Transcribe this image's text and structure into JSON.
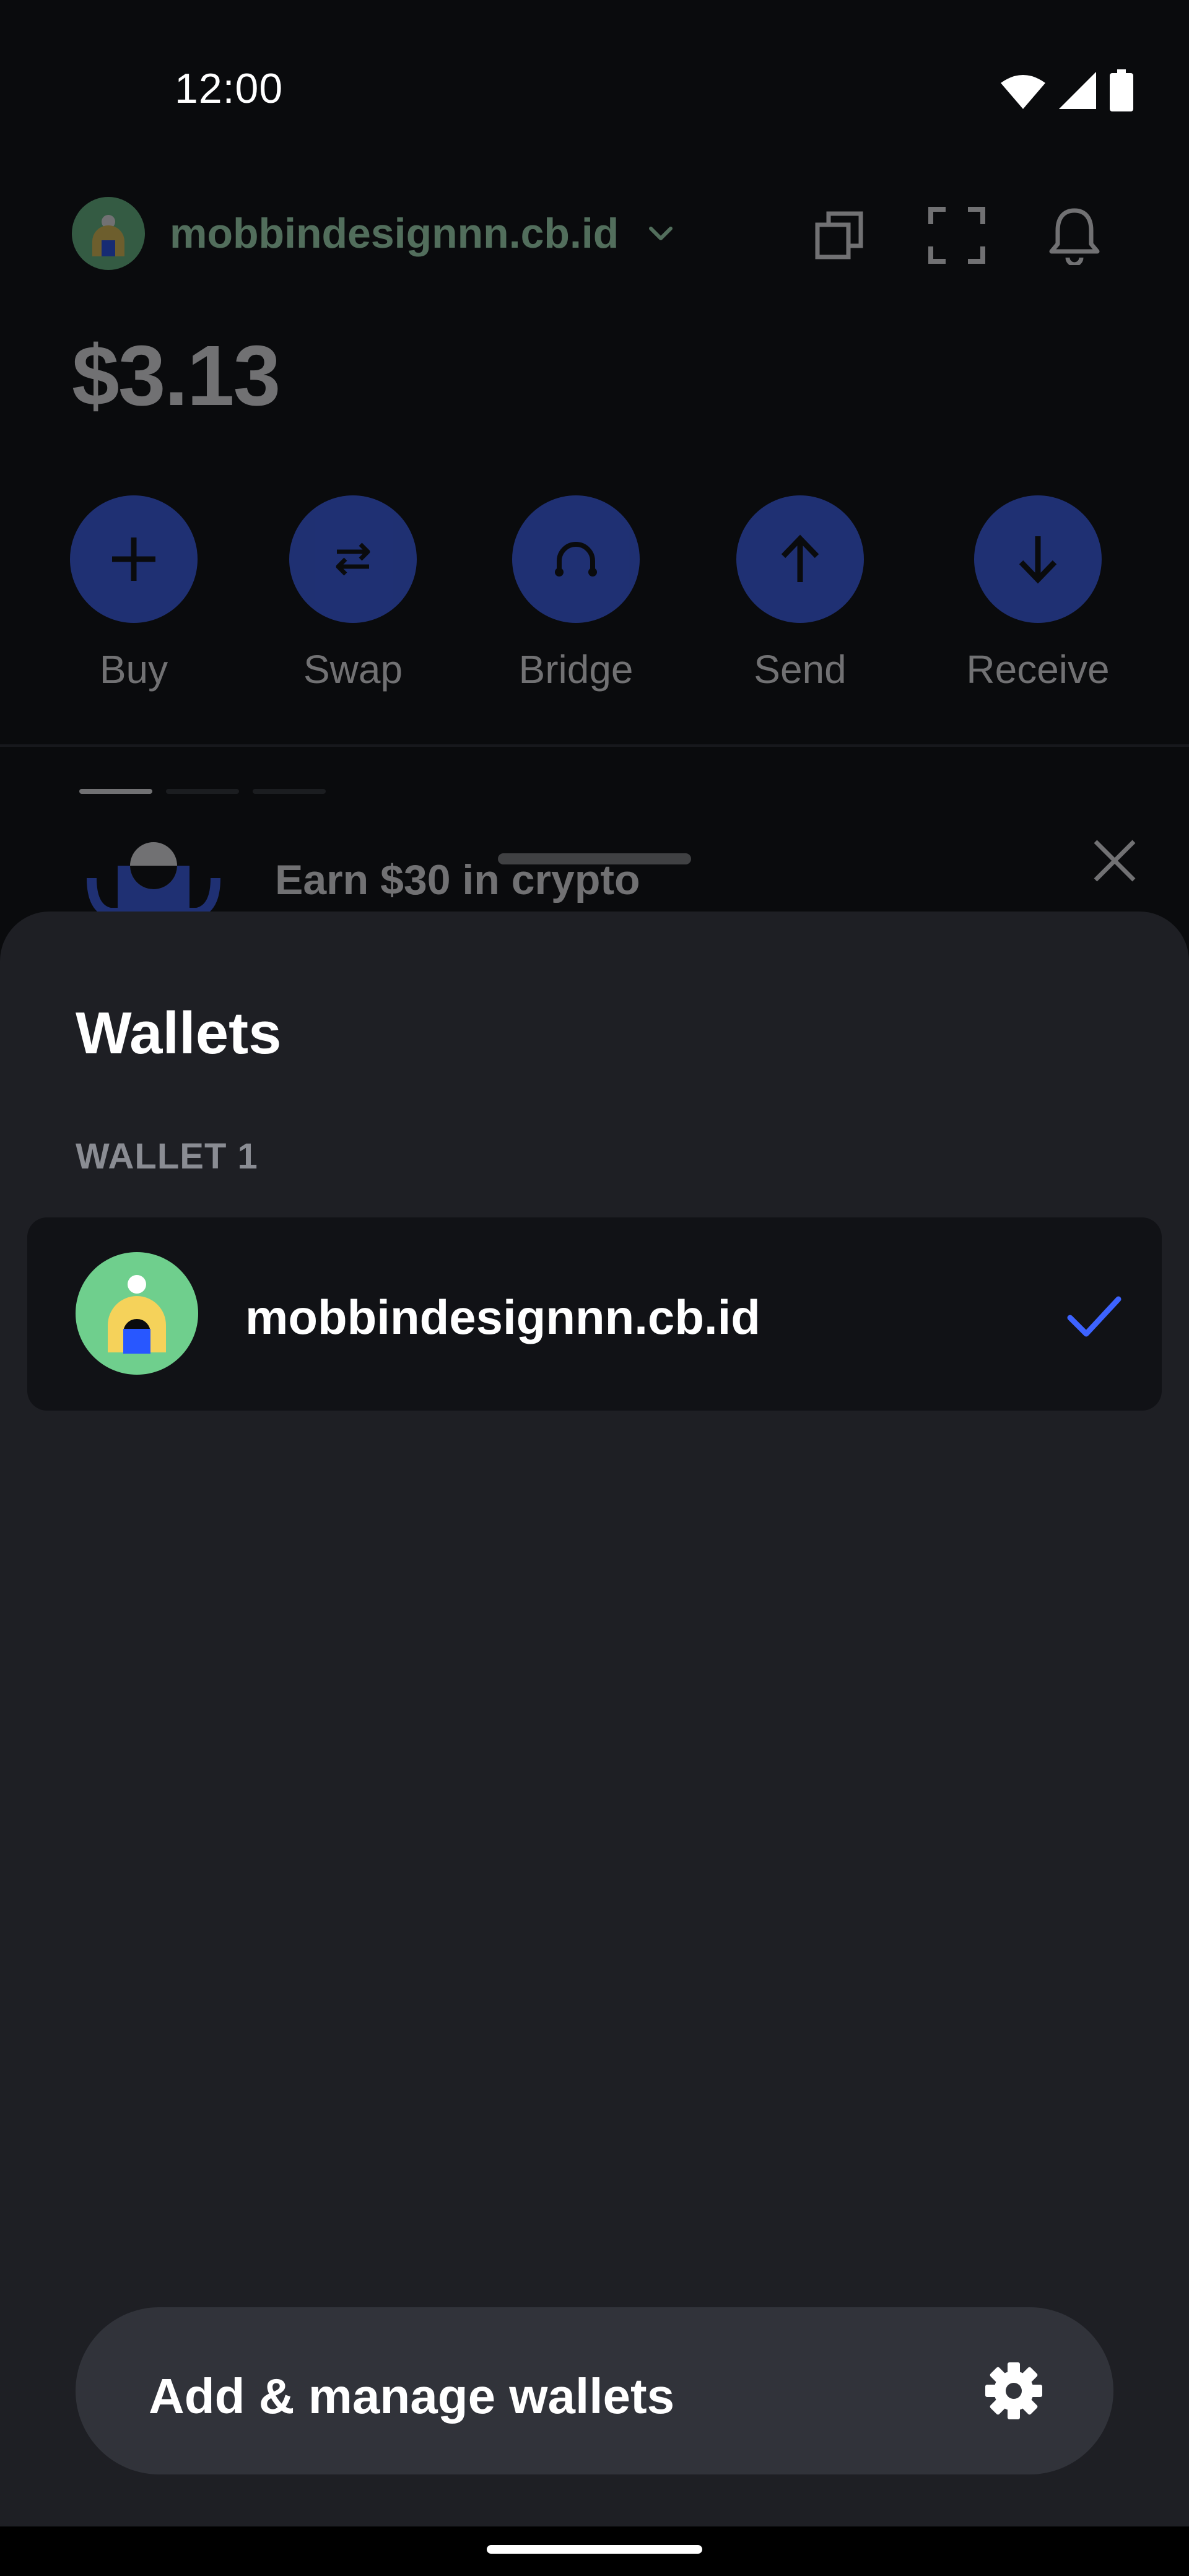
{
  "status_bar": {
    "time": "12:00",
    "icons": [
      "wifi-icon",
      "cell-signal-icon",
      "battery-icon"
    ]
  },
  "home": {
    "wallet_name": "mobbindesignnn.cb.id",
    "header_icons": [
      "copy-icon",
      "scan-icon",
      "bell-icon"
    ],
    "balance": "$3.13",
    "actions": [
      {
        "label": "Buy",
        "icon": "plus-icon"
      },
      {
        "label": "Swap",
        "icon": "swap-icon"
      },
      {
        "label": "Bridge",
        "icon": "bridge-icon"
      },
      {
        "label": "Send",
        "icon": "arrow-up-icon"
      },
      {
        "label": "Receive",
        "icon": "arrow-down-icon"
      }
    ],
    "promo": {
      "title": "Earn $30 in crypto",
      "close_icon": "close-icon"
    }
  },
  "sheet": {
    "title": "Wallets",
    "section_label": "WALLET 1",
    "wallets": [
      {
        "name": "mobbindesignnn.cb.id",
        "selected": true
      }
    ],
    "manage_button": "Add & manage wallets",
    "manage_icon": "gear-icon"
  },
  "colors": {
    "accent_blue": "#3d63ff",
    "check_blue": "#3d63ff",
    "sheet_bg": "#1e1f24",
    "row_bg": "#111216",
    "avatar_green": "#6fcf8d"
  }
}
